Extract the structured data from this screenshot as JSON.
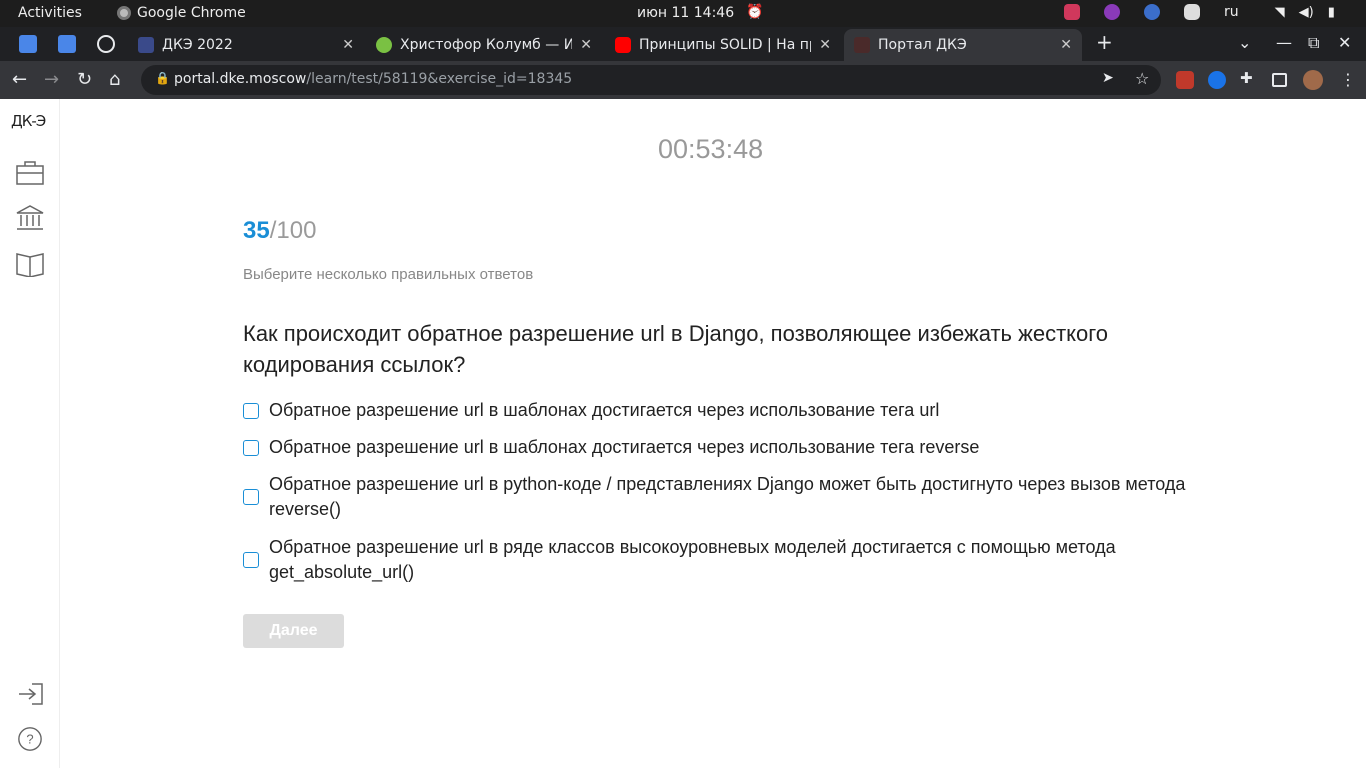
{
  "topbar": {
    "activities": "Activities",
    "app_name": "Google Chrome",
    "datetime": "июн 11  14:46",
    "language": "ru"
  },
  "tabs": [
    {
      "title": "ДКЭ 2022"
    },
    {
      "title": "Христофор Колумб — Ис"
    },
    {
      "title": "Принципы SOLID | На пр"
    },
    {
      "title": "Портал ДКЭ"
    }
  ],
  "toolbar": {
    "url_host": "portal.dke.moscow",
    "url_path": "/learn/test/58119&exercise_id=18345"
  },
  "sidebar": {
    "logo": "ДК-Э"
  },
  "test": {
    "timer": "00:53:48",
    "score_current": "35",
    "score_total": "/100",
    "instruction": "Выберите несколько правильных ответов",
    "question": "Как происходит обратное разрешение url в Django, позволяющее избежать жесткого кодирования ссылок?",
    "answers": [
      "Обратное разрешение url в шаблонах достигается через использование тега url",
      "Обратное разрешение url в шаблонах достигается через использование тега reverse",
      "Обратное разрешение url в python-коде / представлениях Django может быть достигнуто через вызов метода reverse()",
      "Обратное разрешение url в ряде классов высокоуровневых моделей достигается с помощью метода get_absolute_url()"
    ],
    "next_label": "Далее"
  },
  "colors": {
    "accent": "#1a8ed6",
    "disabled_button": "#dcdcdc",
    "chrome_dark": "#202124",
    "chrome_toolbar": "#35363a"
  }
}
